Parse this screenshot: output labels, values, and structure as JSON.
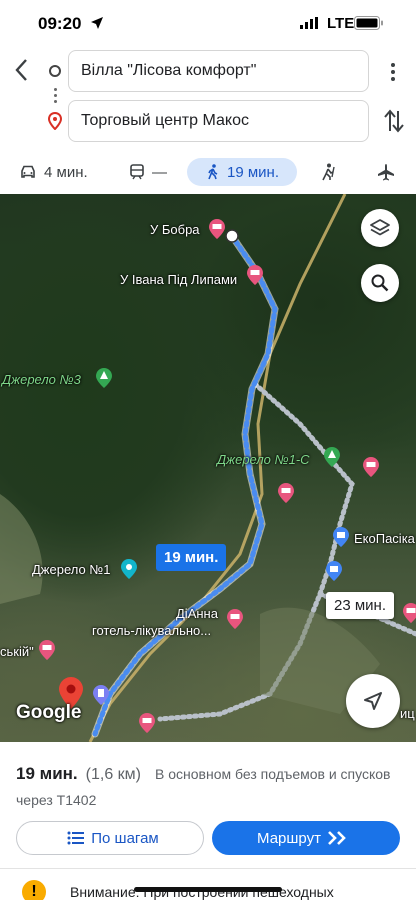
{
  "status_bar": {
    "time": "09:20",
    "network": "LTE"
  },
  "route": {
    "origin": "Вілла \"Лісова комфорт\"",
    "destination": "Торговый центр Макос"
  },
  "modes": [
    {
      "id": "car",
      "label": "4 мин.",
      "icon": "car-icon"
    },
    {
      "id": "transit",
      "label": "—",
      "icon": "transit-icon"
    },
    {
      "id": "walk",
      "label": "19 мин.",
      "icon": "walk-icon",
      "selected": true
    },
    {
      "id": "ride",
      "label": "",
      "icon": "ride-icon"
    },
    {
      "id": "flight",
      "label": "",
      "icon": "flight-icon"
    }
  ],
  "map": {
    "pois": [
      {
        "name": "У Бобра",
        "kind": "hotel"
      },
      {
        "name": "У Івана Під Липами",
        "kind": "hotel"
      },
      {
        "name": "Джерело №3",
        "kind": "spring"
      },
      {
        "name": "Джерело №1-С",
        "kind": "spring"
      },
      {
        "name": "ЕкоПасіка",
        "kind": "shop"
      },
      {
        "name": "Джерело №1",
        "kind": "attraction"
      },
      {
        "name": "ДіАнна",
        "kind": "hotel"
      },
      {
        "name": "готель-лікувально...",
        "kind": "hotel"
      },
      {
        "name": "ській\"",
        "kind": "hotel"
      },
      {
        "name": "иц",
        "kind": "other"
      }
    ],
    "route_time_main": "19 мин.",
    "route_time_alt": "23 мин.",
    "logo": "Google",
    "colors": {
      "route": "#4a8cf0",
      "alt_route": "#b9c0c9",
      "road": "#d9c27a",
      "accent": "#1a73e8"
    }
  },
  "summary": {
    "time": "19 мин.",
    "distance": "(1,6 км)",
    "note": "В основном без подъемов и спусков",
    "via": "через Т1402"
  },
  "actions": {
    "steps": "По шагам",
    "route": "Маршрут"
  },
  "warning": {
    "text": "Внимание: При построении пешеходных"
  }
}
